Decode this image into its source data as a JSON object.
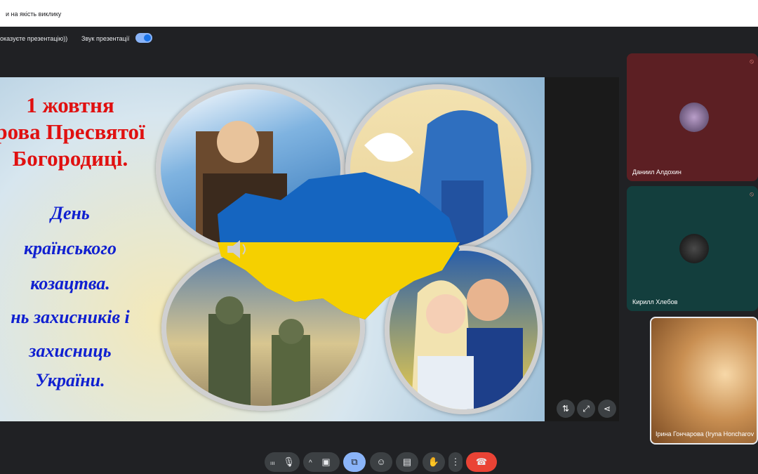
{
  "topbar": {
    "title": "и на якість виклику"
  },
  "subbar": {
    "presenting_hint": "оказуєте презентацію))",
    "sound_label": "Звук презентації"
  },
  "slide": {
    "lines_red": [
      "1 жовтня",
      "рова Пресвятої",
      "Богородиці."
    ],
    "lines_blue": [
      "День",
      "країнського",
      "козацтва.",
      "нь захисників і",
      "захисниць",
      "України."
    ],
    "colors": {
      "red": "#e01010",
      "blue": "#1020d0",
      "flag_blue": "#1565c0",
      "flag_yellow": "#f5d000"
    }
  },
  "slide_controls": {
    "icons": [
      "swap-icon",
      "fullscreen-icon",
      "share-icon"
    ]
  },
  "participants": [
    {
      "name": "Даниил Алдохин"
    },
    {
      "name": "Кирилл Хлебов"
    },
    {
      "name": "Ірина Гончарова (Iryna Honcharov"
    }
  ],
  "controls": {
    "end_call_color": "#ea4335"
  }
}
